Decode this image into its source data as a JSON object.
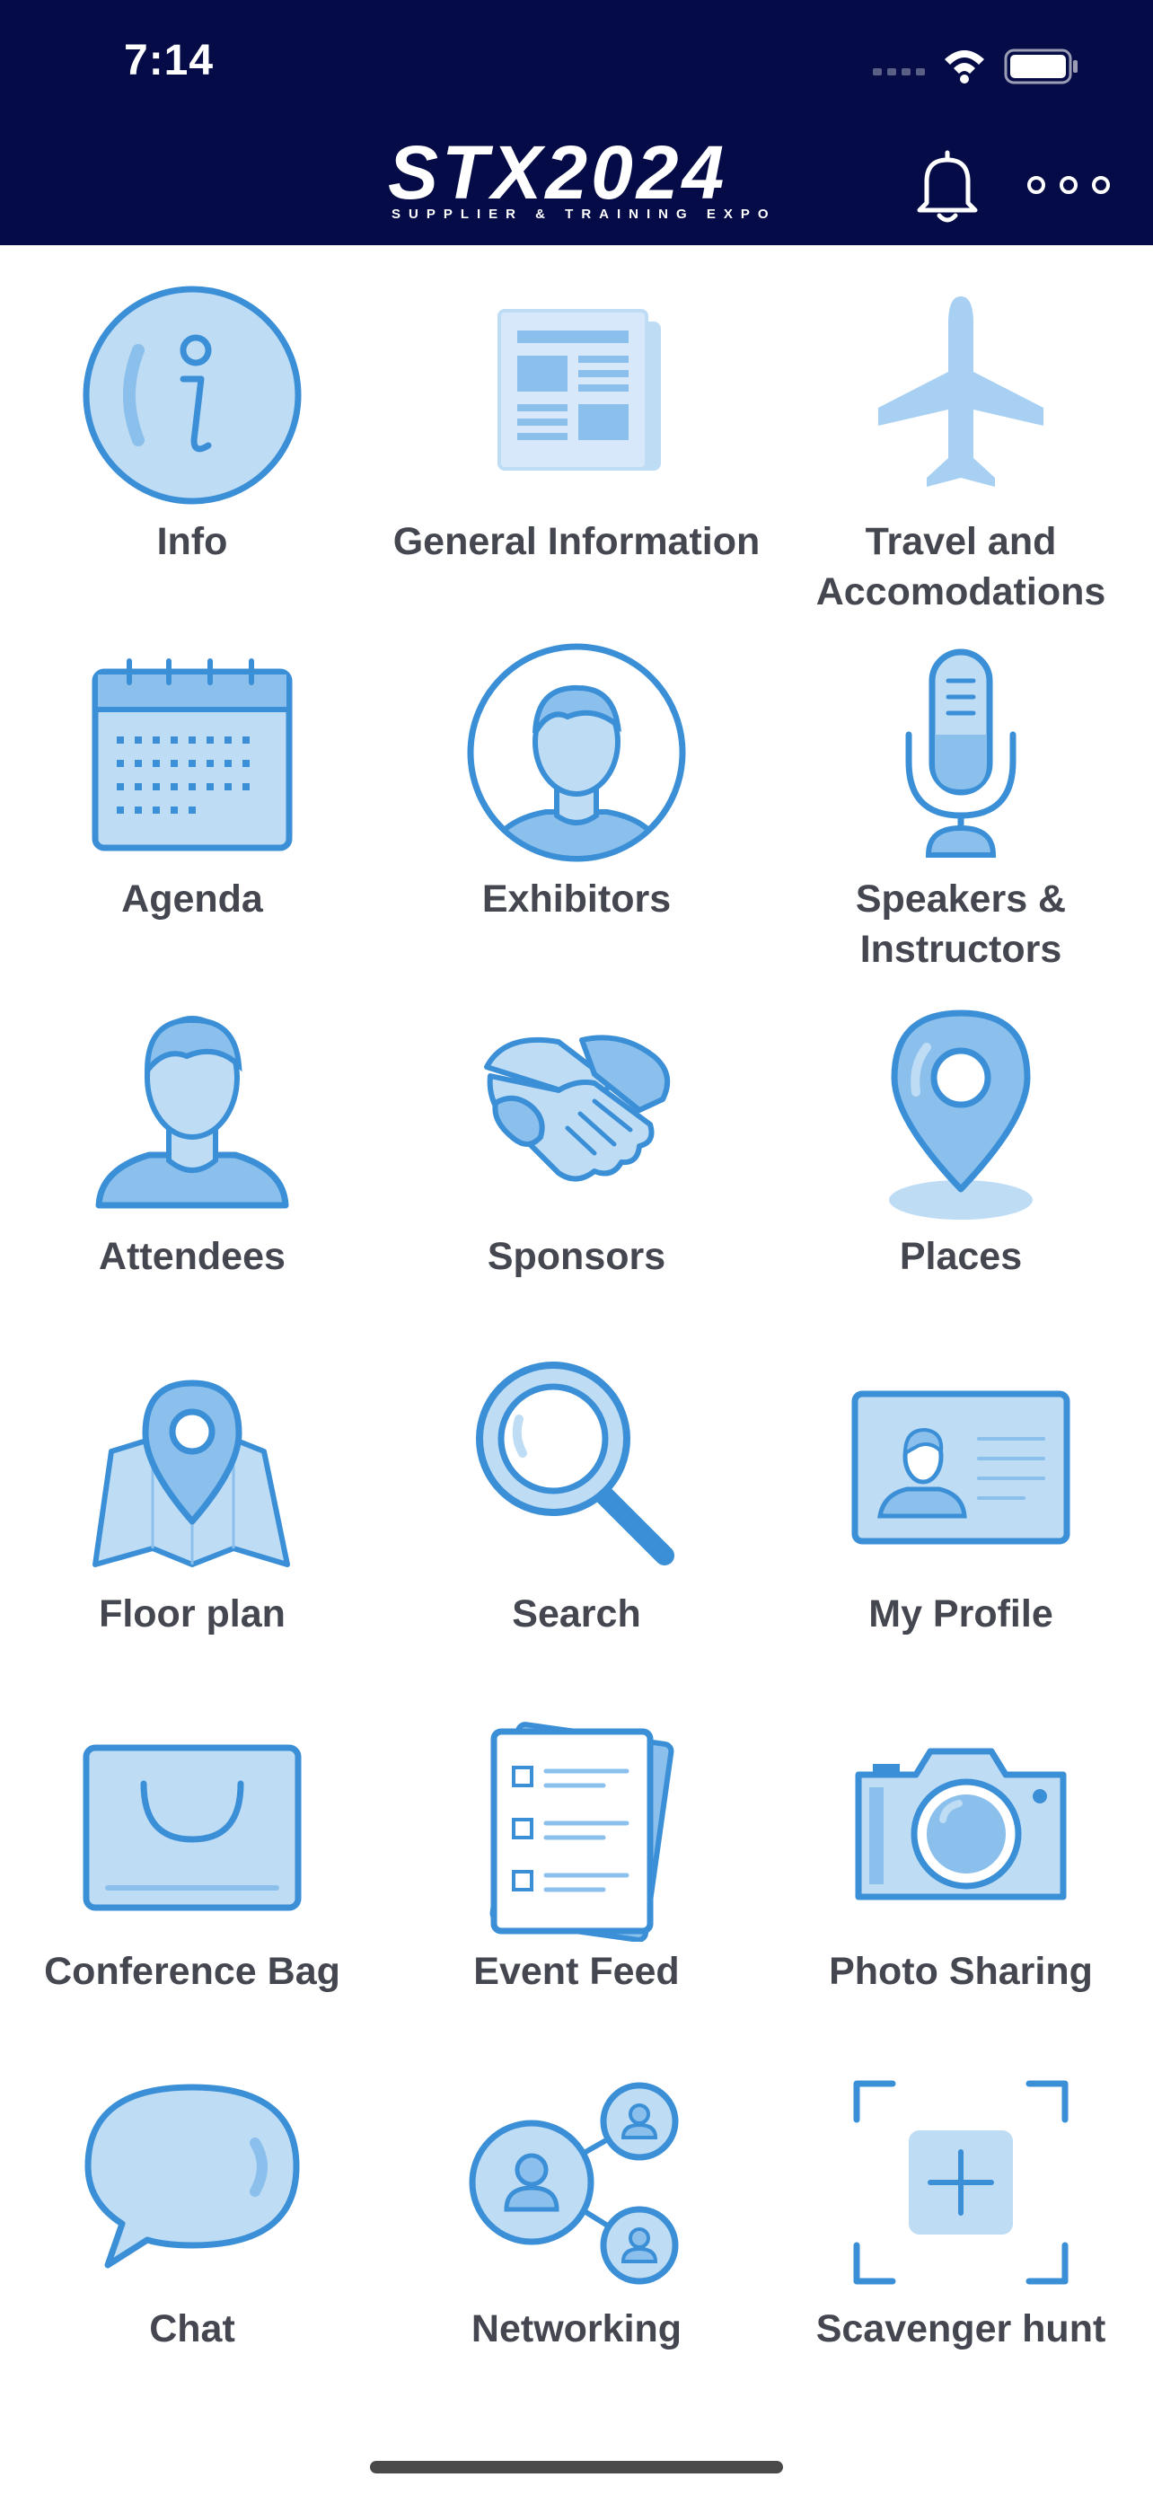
{
  "status_bar": {
    "time": "7:14"
  },
  "header": {
    "logo_main": "STX2024",
    "logo_sub": "SUPPLIER & TRAINING EXPO",
    "bell_icon": "bell-icon",
    "more_icon": "more-horizontal-icon"
  },
  "colors": {
    "header_bg": "#050b47",
    "icon_light": "#bfdcf5",
    "icon_mid": "#8bbfec",
    "icon_stroke": "#3b8fd6",
    "label": "#444750"
  },
  "tiles": [
    {
      "label": "Info",
      "icon": "info-icon"
    },
    {
      "label": "General Information",
      "icon": "newspaper-icon"
    },
    {
      "label": "Travel and Accomodations",
      "icon": "airplane-icon"
    },
    {
      "label": "Agenda",
      "icon": "calendar-icon"
    },
    {
      "label": "Exhibitors",
      "icon": "person-circle-icon"
    },
    {
      "label": "Speakers & Instructors",
      "icon": "microphone-icon"
    },
    {
      "label": "Attendees",
      "icon": "person-icon"
    },
    {
      "label": "Sponsors",
      "icon": "handshake-icon"
    },
    {
      "label": "Places",
      "icon": "map-pin-icon"
    },
    {
      "label": "Floor plan",
      "icon": "map-icon"
    },
    {
      "label": "Search",
      "icon": "magnifier-icon"
    },
    {
      "label": "My Profile",
      "icon": "id-card-icon"
    },
    {
      "label": "Conference Bag",
      "icon": "bag-icon"
    },
    {
      "label": "Event Feed",
      "icon": "feed-list-icon"
    },
    {
      "label": "Photo Sharing",
      "icon": "camera-icon"
    },
    {
      "label": "Chat",
      "icon": "speech-bubble-icon"
    },
    {
      "label": "Networking",
      "icon": "network-icon"
    },
    {
      "label": "Scavenger hunt",
      "icon": "scan-plus-icon"
    }
  ]
}
